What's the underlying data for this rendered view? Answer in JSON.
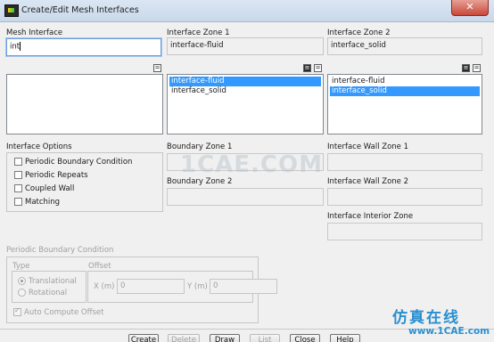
{
  "window": {
    "title": "Create/Edit Mesh Interfaces",
    "close_glyph": "✕"
  },
  "mesh_interface": {
    "label": "Mesh Interface",
    "value": "int"
  },
  "interface_zone_1": {
    "label": "Interface Zone 1",
    "value": "interface-fluid",
    "items": [
      {
        "label": "interface-fluid",
        "selected": true
      },
      {
        "label": "interface_solid",
        "selected": false
      }
    ]
  },
  "interface_zone_2": {
    "label": "Interface Zone 2",
    "value": "interface_solid",
    "items": [
      {
        "label": "interface-fluid",
        "selected": false
      },
      {
        "label": "interface_solid",
        "selected": true
      }
    ]
  },
  "interface_options": {
    "label": "Interface Options",
    "items": [
      {
        "label": "Periodic Boundary Condition",
        "checked": false
      },
      {
        "label": "Periodic Repeats",
        "checked": false
      },
      {
        "label": "Coupled Wall",
        "checked": false
      },
      {
        "label": "Matching",
        "checked": false
      }
    ]
  },
  "boundary_zone_1": {
    "label": "Boundary Zone 1"
  },
  "boundary_zone_2": {
    "label": "Boundary Zone 2"
  },
  "interface_wall_zone_1": {
    "label": "Interface Wall Zone 1"
  },
  "interface_wall_zone_2": {
    "label": "Interface Wall Zone 2"
  },
  "interface_interior_zone": {
    "label": "Interface Interior Zone"
  },
  "periodic": {
    "label": "Periodic Boundary Condition",
    "type_label": "Type",
    "translational": "Translational",
    "rotational": "Rotational",
    "offset_label": "Offset",
    "x_label": "X (m)",
    "x_value": "0",
    "y_label": "Y (m)",
    "y_value": "0",
    "auto_compute": "Auto Compute Offset",
    "auto_compute_checked": true
  },
  "buttons": {
    "create": "Create",
    "delete": "Delete",
    "draw": "Draw",
    "list": "List",
    "close": "Close",
    "help": "Help"
  },
  "list_controls": {
    "filter_glyph": "=",
    "select_all_glyph": "≡"
  },
  "watermark": {
    "text": "1CAE.COM",
    "brand_cn": "仿真在线",
    "brand_url": "www.1CAE.com"
  },
  "colors": {
    "selection": "#3399ff",
    "window_bg": "#f0f0f0",
    "brand": "#2a8fd0"
  }
}
